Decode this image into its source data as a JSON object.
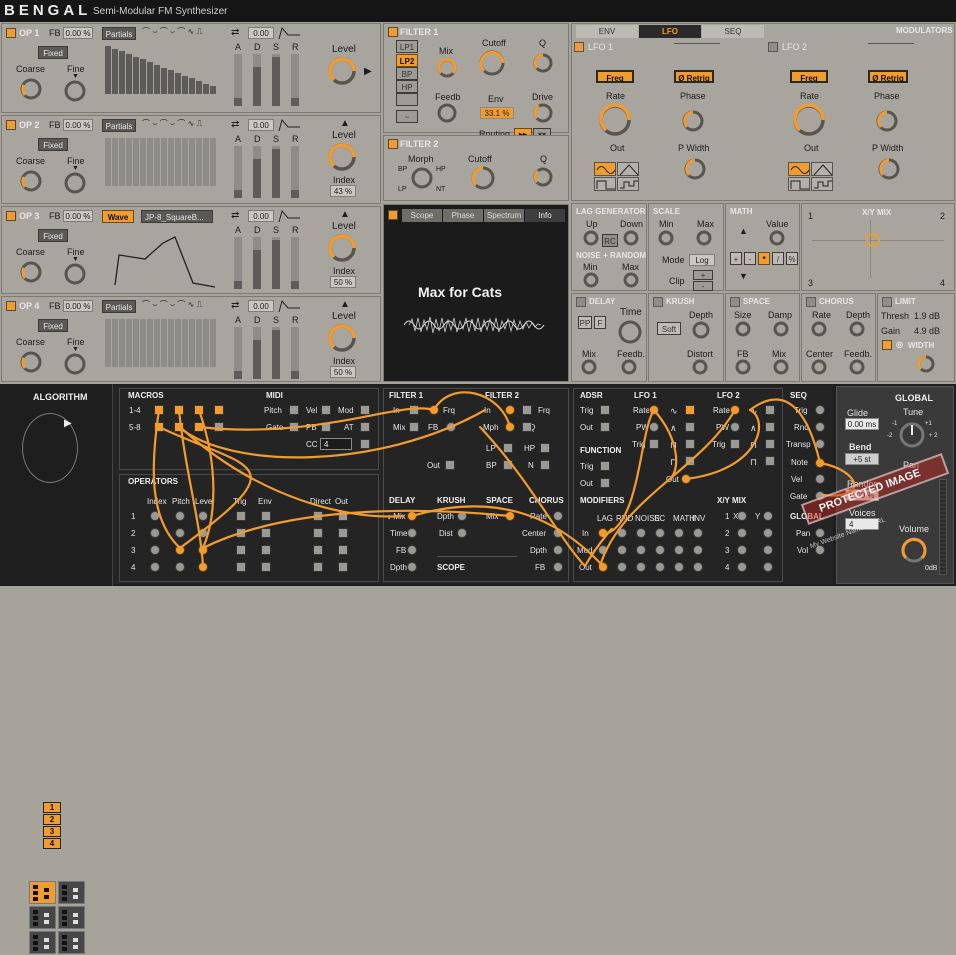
{
  "header": {
    "title": "BENGAL",
    "subtitle": "Semi-Modular FM Synthesizer"
  },
  "ops": [
    {
      "name": "OP 1",
      "fb": "0.00 %",
      "mode": "Fixed",
      "coarse": "Coarse",
      "fine": "Fine",
      "source": "Partials",
      "env_val": "0.00",
      "level": "Level"
    },
    {
      "name": "OP 2",
      "fb": "0.00 %",
      "mode": "Fixed",
      "coarse": "Coarse",
      "fine": "Fine",
      "source": "Partials",
      "env_val": "0.00",
      "level": "Level",
      "index": "Index",
      "index_val": "43 %"
    },
    {
      "name": "OP 3",
      "fb": "0.00 %",
      "mode": "Fixed",
      "coarse": "Coarse",
      "fine": "Fine",
      "source": "Wave",
      "wave_sel": "JP-8_SquareB...",
      "env_val": "0.00",
      "level": "Level",
      "index": "Index",
      "index_val": "50 %"
    },
    {
      "name": "OP 4",
      "fb": "0.00 %",
      "mode": "Fixed",
      "coarse": "Coarse",
      "fine": "Fine",
      "source": "Partials",
      "env_val": "0.00",
      "level": "Level",
      "index": "Index",
      "index_val": "50 %"
    }
  ],
  "adsr": [
    "A",
    "D",
    "S",
    "R"
  ],
  "filter1": {
    "title": "FILTER 1",
    "types": [
      "LP1",
      "LP2",
      "BP",
      "HP",
      "",
      "~"
    ],
    "mix": "Mix",
    "cutoff": "Cutoff",
    "q": "Q",
    "feedb": "Feedb",
    "env": "Env",
    "env_val": "33.1 %",
    "drive": "Drive",
    "routing": "Routing"
  },
  "filter2": {
    "title": "FILTER 2",
    "morph": "Morph",
    "cutoff": "Cutoff",
    "q": "Q",
    "bp": "BP",
    "hp": "HP",
    "lp": "LP",
    "nt": "NT"
  },
  "scope": {
    "tabs": [
      "Scope",
      "Phase",
      "Spectrum",
      "Info"
    ],
    "text": "Max for Cats"
  },
  "mod_tabs": {
    "tabs": [
      "ENV",
      "LFO",
      "SEQ"
    ],
    "right": "MODULATORS"
  },
  "lfo1": {
    "title": "LFO 1",
    "freq": "Freq",
    "retrig": "Ø Retrig",
    "rate": "Rate",
    "phase": "Phase",
    "out": "Out",
    "pwidth": "P Width"
  },
  "lfo2": {
    "title": "LFO 2",
    "freq": "Freq",
    "retrig": "Ø Retrig",
    "rate": "Rate",
    "phase": "Phase",
    "out": "Out",
    "pwidth": "P Width"
  },
  "lag": {
    "title": "LAG GENERATOR",
    "up": "Up",
    "down": "Down",
    "rc": "RC",
    "noise": "NOISE + RANDOM",
    "min": "Min",
    "max": "Max"
  },
  "scale": {
    "title": "SCALE",
    "min": "Min",
    "max": "Max",
    "mode": "Mode",
    "mode_val": "Log",
    "clip": "Clip"
  },
  "math": {
    "title": "MATH",
    "value": "Value",
    "ops": [
      "+",
      "-",
      "*",
      "/",
      "%"
    ]
  },
  "xymix": {
    "title": "X/Y MIX",
    "c1": "1",
    "c2": "2",
    "c3": "3",
    "c4": "4"
  },
  "delay": {
    "title": "DELAY",
    "pp": "PP",
    "f": "F",
    "time": "Time",
    "mix": "Mix",
    "feedb": "Feedb."
  },
  "krush": {
    "title": "KRUSH",
    "soft": "Soft",
    "depth": "Depth",
    "distort": "Distort"
  },
  "space": {
    "title": "SPACE",
    "size": "Size",
    "damp": "Damp",
    "fb": "FB",
    "mix": "Mix"
  },
  "chorus": {
    "title": "CHORUS",
    "rate": "Rate",
    "depth": "Depth",
    "center": "Center",
    "feedb": "Feedb."
  },
  "limit": {
    "title": "LIMIT",
    "thresh": "Thresh",
    "thresh_val": "1.9 dB",
    "gain": "Gain",
    "gain_val": "4.9 dB",
    "width": "WIDTH"
  },
  "algorithm": {
    "title": "ALGORITHM",
    "ops": [
      "1",
      "2",
      "3",
      "4"
    ]
  },
  "patch": {
    "macros": "MACROS",
    "m14": "1-4",
    "m58": "5-8",
    "midi": "MIDI",
    "pitch": "Pitch",
    "vel": "Vel",
    "mod": "Mod",
    "gate": "Gate",
    "pb": "PB",
    "at": "AT",
    "cc": "CC",
    "cc_val": "4",
    "filter1": "FILTER 1",
    "f1in": "In",
    "f1frq": "Frq",
    "f1mix": "Mix",
    "f1fb": "FB",
    "f1out": "Out",
    "filter2": "FILTER 2",
    "f2in": "In",
    "f2frq": "Frq",
    "f2mph": "Mph",
    "f2q": "Q",
    "f2lp": "LP",
    "f2hp": "HP",
    "f2bp": "BP",
    "f2n": "N",
    "operators": "OPERATORS",
    "op_cols": [
      "Index",
      "Pitch",
      "Level",
      "Trig",
      "Env",
      "Direct",
      "Out"
    ],
    "op_rows": [
      "1",
      "2",
      "3",
      "4"
    ],
    "delay": "DELAY",
    "dmix": "↓ Mix",
    "dtime": "Time",
    "dfb": "FB",
    "ddpth": "Dpth",
    "krush": "KRUSH",
    "kdpth": "Dpth",
    "kdist": "Dist",
    "space": "SPACE",
    "smix": "Mix",
    "chorus": "CHORUS",
    "crate": "Rate",
    "ccenter": "Center",
    "cdpth": "Dpth",
    "cfb": "FB",
    "scope": "SCOPE",
    "adsr": "ADSR",
    "atrig": "Trig",
    "aout": "Out",
    "function": "FUNCTION",
    "fntrig": "Trig",
    "fnout": "Out",
    "lfo1": "LFO 1",
    "l1rate": "Rate",
    "l1pw": "PW",
    "l1trig": "Trig",
    "l1out": "Out",
    "lfo2": "LFO 2",
    "l2rate": "Rate",
    "l2pw": "PW",
    "l2trig": "Trig",
    "modifiers": "MODIFIERS",
    "mod_cols": [
      "LAG",
      "RND",
      "NOISE",
      "SC",
      "MATH",
      "INV"
    ],
    "min": "In",
    "mmod": "Mod",
    "mout": "Out",
    "xymix": "X/Y MIX",
    "xx": "X",
    "xy": "Y",
    "seq": "SEQ",
    "strig": "Trig",
    "srnd": "Rnd",
    "stransp": "Transp",
    "snote": "Note",
    "svel": "Vel",
    "sgate": "Gate",
    "global2": "GLOBAL",
    "gpan": "Pan",
    "gvol": "Vol"
  },
  "global": {
    "title": "GLOBAL",
    "glide": "Glide",
    "glide_val": "0.00 ms",
    "tune": "Tune",
    "bend": "Bend",
    "bend_val": "+5 st",
    "random": "Random",
    "random_val": "0.00 %",
    "voices": "Voices",
    "voices_val": "4",
    "pan": "Pan",
    "volume": "Volume",
    "vol_val": "0dB",
    "t_neg2": "-2",
    "t_neg1": "-1",
    "t_p1": "+1",
    "t_p2": "+ 2"
  },
  "watermark": {
    "line1": "PROTECTED IMAGE",
    "line2": "My Website Name & URL"
  },
  "colors": {
    "accent": "#f29b2e",
    "panel": "#a8a59e",
    "dark": "#1e1e1e",
    "cable": "#f29b2e"
  }
}
